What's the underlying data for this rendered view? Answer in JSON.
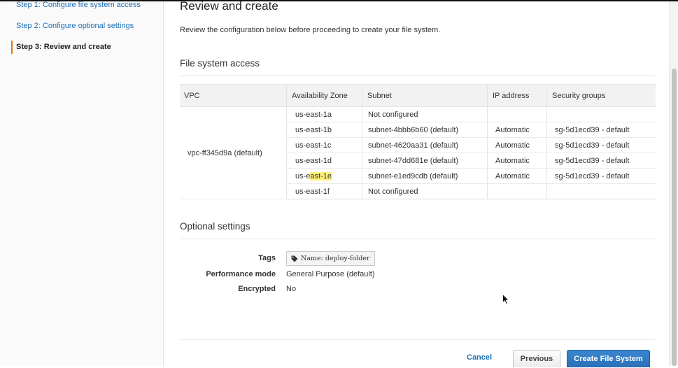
{
  "steps": [
    {
      "label": "Step 1: Configure file system access"
    },
    {
      "label": "Step 2: Configure optional settings"
    },
    {
      "label": "Step 3: Review and create"
    }
  ],
  "page": {
    "title": "Review and create",
    "description": "Review the configuration below before proceeding to create your file system."
  },
  "file_system_access": {
    "title": "File system access",
    "headers": [
      "VPC",
      "Availability Zone",
      "Subnet",
      "IP address",
      "Security groups"
    ],
    "vpc": "vpc-ff345d9a (default)",
    "rows": [
      {
        "az": "us-east-1a",
        "subnet": "Not configured",
        "ip": "",
        "sg": ""
      },
      {
        "az": "us-east-1b",
        "subnet": "subnet-4bbb6b60 (default)",
        "ip": "Automatic",
        "sg": "sg-5d1ecd39 - default"
      },
      {
        "az": "us-east-1c",
        "subnet": "subnet-4620aa31 (default)",
        "ip": "Automatic",
        "sg": "sg-5d1ecd39 - default"
      },
      {
        "az": "us-east-1d",
        "subnet": "subnet-47dd681e (default)",
        "ip": "Automatic",
        "sg": "sg-5d1ecd39 - default"
      },
      {
        "az_prefix": "us-e",
        "az_highlight": "ast-1e",
        "subnet": "subnet-e1ed9cdb (default)",
        "ip": "Automatic",
        "sg": "sg-5d1ecd39 - default"
      },
      {
        "az": "us-east-1f",
        "subnet": "Not configured",
        "ip": "",
        "sg": ""
      }
    ]
  },
  "optional_settings": {
    "title": "Optional settings",
    "tags_label": "Tags",
    "tag_value": "Name: deploy-folder",
    "performance_label": "Performance mode",
    "performance_value": "General Purpose (default)",
    "encrypted_label": "Encrypted",
    "encrypted_value": "No"
  },
  "actions": {
    "cancel": "Cancel",
    "previous": "Previous",
    "create": "Create File System"
  },
  "colors": {
    "link": "#1f6fb5",
    "primary_button": "#2b6fb6",
    "step_marker": "#e47911",
    "highlight": "#fff17a"
  }
}
